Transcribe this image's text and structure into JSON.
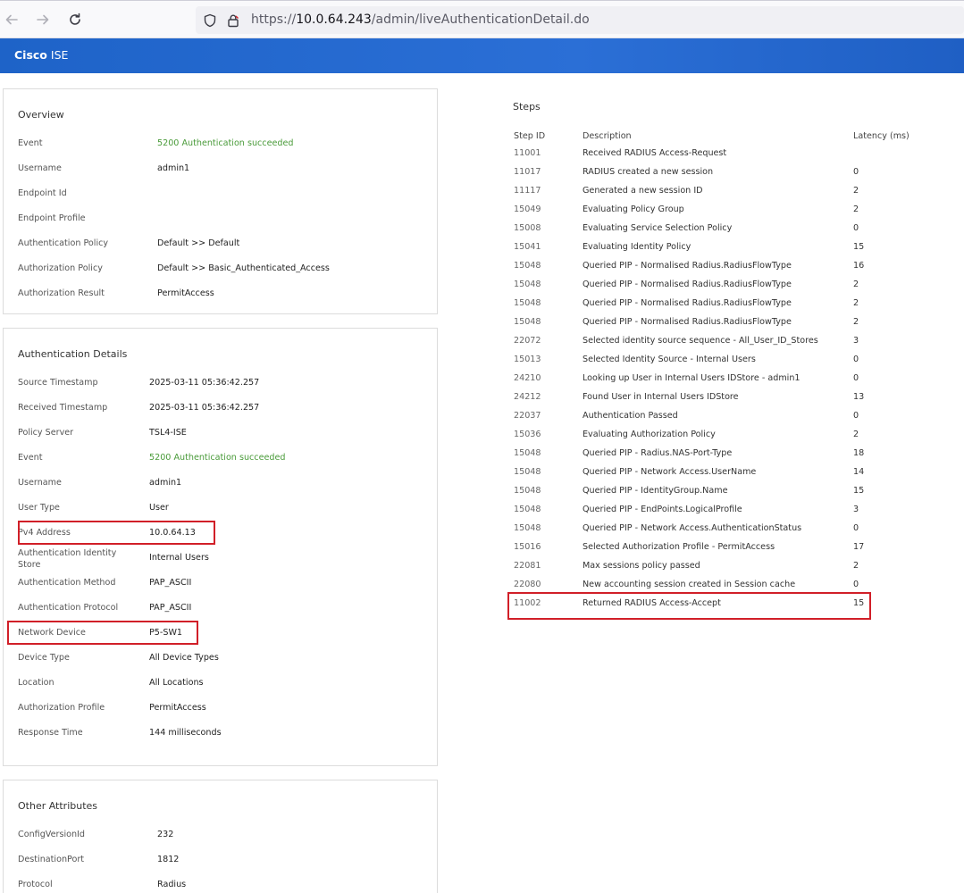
{
  "browser": {
    "url_scheme": "https://",
    "url_host": "10.0.64.243",
    "url_path": "/admin/liveAuthenticationDetail.do",
    "icons": [
      "back-arrow-icon",
      "forward-arrow-icon",
      "reload-icon",
      "shield-icon",
      "lock-icon"
    ]
  },
  "app": {
    "brand_bold": "Cisco",
    "brand_rest": "ISE",
    "header_color": "#1e63c8"
  },
  "overview": {
    "title": "Overview",
    "rows": [
      {
        "key": "Event",
        "value": "5200 Authentication succeeded",
        "status": "success"
      },
      {
        "key": "Username",
        "value": "admin1"
      },
      {
        "key": "Endpoint Id",
        "value": ""
      },
      {
        "key": "Endpoint Profile",
        "value": ""
      },
      {
        "key": "Authentication Policy",
        "value": "Default >> Default"
      },
      {
        "key": "Authorization Policy",
        "value": "Default >> Basic_Authenticated_Access"
      },
      {
        "key": "Authorization Result",
        "value": "PermitAccess"
      }
    ]
  },
  "auth_details": {
    "title": "Authentication Details",
    "rows": [
      {
        "key": "Source Timestamp",
        "value": "2025-03-11 05:36:42.257"
      },
      {
        "key": "Received Timestamp",
        "value": "2025-03-11 05:36:42.257"
      },
      {
        "key": "Policy Server",
        "value": "TSL4-ISE"
      },
      {
        "key": "Event",
        "value": "5200 Authentication succeeded",
        "status": "success"
      },
      {
        "key": "Username",
        "value": "admin1"
      },
      {
        "key": "User Type",
        "value": "User"
      },
      {
        "key": "Pv4 Address",
        "value": "10.0.64.13",
        "highlighted": true
      },
      {
        "key_line1": "Authentication Identity",
        "key_line2": "Store",
        "value": "Internal Users"
      },
      {
        "key": "Authentication Method",
        "value": "PAP_ASCII"
      },
      {
        "key": "Authentication Protocol",
        "value": "PAP_ASCII"
      },
      {
        "key": "Network Device",
        "value": "P5-SW1",
        "highlighted": true
      },
      {
        "key": "Device Type",
        "value": "All Device Types"
      },
      {
        "key": "Location",
        "value": "All Locations"
      },
      {
        "key": "Authorization Profile",
        "value": "PermitAccess"
      },
      {
        "key": "Response Time",
        "value": "144 milliseconds"
      }
    ]
  },
  "other_attributes": {
    "title": "Other Attributes",
    "rows": [
      {
        "key": "ConfigVersionId",
        "value": "232"
      },
      {
        "key": "DestinationPort",
        "value": "1812"
      },
      {
        "key": "Protocol",
        "value": "Radius"
      }
    ]
  },
  "steps": {
    "title": "Steps",
    "headers": {
      "id": "Step ID",
      "desc": "Description",
      "latency": "Latency (ms)"
    },
    "rows": [
      {
        "id": "11001",
        "desc": "Received RADIUS Access-Request",
        "latency": ""
      },
      {
        "id": "11017",
        "desc": "RADIUS created a new session",
        "latency": "0"
      },
      {
        "id": "11117",
        "desc": "Generated a new session ID",
        "latency": "2"
      },
      {
        "id": "15049",
        "desc": "Evaluating Policy Group",
        "latency": "2"
      },
      {
        "id": "15008",
        "desc": "Evaluating Service Selection Policy",
        "latency": "0"
      },
      {
        "id": "15041",
        "desc": "Evaluating Identity Policy",
        "latency": "15"
      },
      {
        "id": "15048",
        "desc": "Queried PIP - Normalised Radius.RadiusFlowType",
        "latency": "16"
      },
      {
        "id": "15048",
        "desc": "Queried PIP - Normalised Radius.RadiusFlowType",
        "latency": "2"
      },
      {
        "id": "15048",
        "desc": "Queried PIP - Normalised Radius.RadiusFlowType",
        "latency": "2"
      },
      {
        "id": "15048",
        "desc": "Queried PIP - Normalised Radius.RadiusFlowType",
        "latency": "2"
      },
      {
        "id": "22072",
        "desc": "Selected identity source sequence - All_User_ID_Stores",
        "latency": "3"
      },
      {
        "id": "15013",
        "desc": "Selected Identity Source - Internal Users",
        "latency": "0"
      },
      {
        "id": "24210",
        "desc": "Looking up User in Internal Users IDStore - admin1",
        "latency": "0"
      },
      {
        "id": "24212",
        "desc": "Found User in Internal Users IDStore",
        "latency": "13"
      },
      {
        "id": "22037",
        "desc": "Authentication Passed",
        "latency": "0"
      },
      {
        "id": "15036",
        "desc": "Evaluating Authorization Policy",
        "latency": "2"
      },
      {
        "id": "15048",
        "desc": "Queried PIP - Radius.NAS-Port-Type",
        "latency": "18"
      },
      {
        "id": "15048",
        "desc": "Queried PIP - Network Access.UserName",
        "latency": "14"
      },
      {
        "id": "15048",
        "desc": "Queried PIP - IdentityGroup.Name",
        "latency": "15"
      },
      {
        "id": "15048",
        "desc": "Queried PIP - EndPoints.LogicalProfile",
        "latency": "3"
      },
      {
        "id": "15048",
        "desc": "Queried PIP - Network Access.AuthenticationStatus",
        "latency": "0"
      },
      {
        "id": "15016",
        "desc": "Selected Authorization Profile - PermitAccess",
        "latency": "17"
      },
      {
        "id": "22081",
        "desc": "Max sessions policy passed",
        "latency": "2"
      },
      {
        "id": "22080",
        "desc": "New accounting session created in Session cache",
        "latency": "0"
      },
      {
        "id": "11002",
        "desc": "Returned RADIUS Access-Accept",
        "latency": "15",
        "highlighted": true
      }
    ]
  },
  "colors": {
    "success_text": "#4a9b3a",
    "highlight_border": "#d11f28"
  }
}
